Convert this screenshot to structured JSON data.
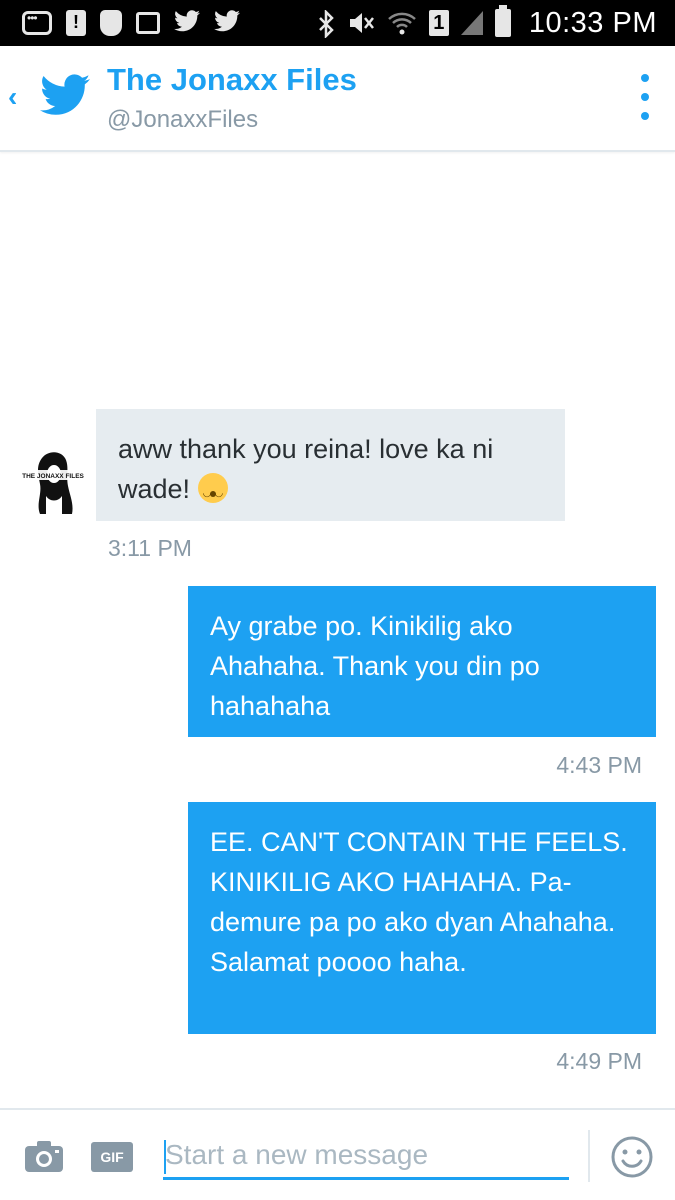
{
  "status_bar": {
    "time": "10:33 PM",
    "sim_slot": "1",
    "icons": [
      "messenger-icon",
      "alert-icon",
      "shield-icon",
      "gallery-icon",
      "twitter-icon",
      "twitter-icon",
      "bluetooth-icon",
      "mute-icon",
      "wifi-icon",
      "sim-icon",
      "signal-icon",
      "battery-icon"
    ]
  },
  "header": {
    "title": "The Jonaxx Files",
    "handle": "@JonaxxFiles"
  },
  "messages": [
    {
      "direction": "incoming",
      "text": "aww thank you reina! love ka ni wade!",
      "emoji": "kissing-smiling-eyes-emoji",
      "time": "3:11 PM"
    },
    {
      "direction": "outgoing",
      "text": "Ay grabe po. Kinikilig ako Ahahaha. Thank you din po hahahaha",
      "time": "4:43 PM"
    },
    {
      "direction": "outgoing",
      "text": "EE. CAN'T CONTAIN THE FEELS. KINIKILIG AKO HAHAHA. Pa-demure pa po ako dyan Ahahaha. Salamat poooo haha.",
      "time": "4:49 PM"
    }
  ],
  "avatar_text": "THE JONAXX FILES",
  "composer": {
    "placeholder": "Start a new message",
    "gif_label": "GIF"
  },
  "colors": {
    "accent": "#1da1f2",
    "incoming_bubble": "#e6ecf0",
    "muted_text": "#8899a6"
  }
}
